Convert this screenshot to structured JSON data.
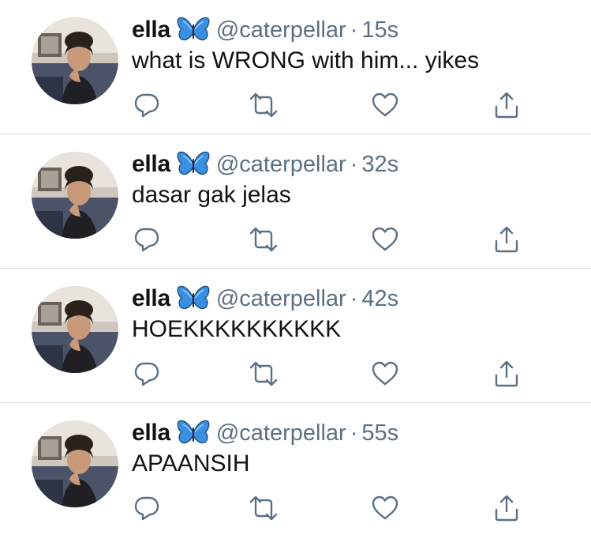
{
  "tweets": [
    {
      "name": "ella",
      "handle": "@caterpellar",
      "separator": "·",
      "time": "15s",
      "text": "what is WRONG with him... yikes"
    },
    {
      "name": "ella",
      "handle": "@caterpellar",
      "separator": "·",
      "time": "32s",
      "text": "dasar gak jelas"
    },
    {
      "name": "ella",
      "handle": "@caterpellar",
      "separator": "·",
      "time": "42s",
      "text": "HOEKKKKKKKKKK"
    },
    {
      "name": "ella",
      "handle": "@caterpellar",
      "separator": "·",
      "time": "55s",
      "text": "APAANSIH"
    }
  ],
  "icons": {
    "badge": "butterfly-emoji",
    "reply": "reply-icon",
    "retweet": "retweet-icon",
    "like": "heart-icon",
    "share": "share-icon"
  },
  "colors": {
    "text": "#0f1419",
    "secondary": "#5b7083",
    "icon": "#5b7083",
    "divider": "#d8dde2",
    "butterfly": "#3b8fe0"
  }
}
